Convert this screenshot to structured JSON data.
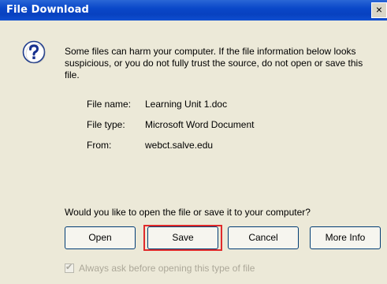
{
  "window": {
    "title": "File Download",
    "close_glyph": "×"
  },
  "message": "Some files can harm your computer. If the file information below looks suspicious, or you do not fully trust the source, do not open or save this file.",
  "file_info": [
    {
      "label": "File name:",
      "value": "Learning Unit 1.doc"
    },
    {
      "label": "File type:",
      "value": "Microsoft Word Document"
    },
    {
      "label": "From:",
      "value": "webct.salve.edu"
    }
  ],
  "question": "Would you like to open the file or save it to your computer?",
  "buttons": {
    "open": "Open",
    "save": "Save",
    "cancel": "Cancel",
    "more_info": "More Info"
  },
  "checkbox": {
    "label": "Always ask before opening this type of file",
    "checked": true,
    "disabled": true
  },
  "colors": {
    "title_bar": "#0a48c9",
    "dialog_bg": "#ece9d8",
    "highlight": "#e02a2a"
  },
  "icons": {
    "dialog_icon": "question-icon"
  }
}
